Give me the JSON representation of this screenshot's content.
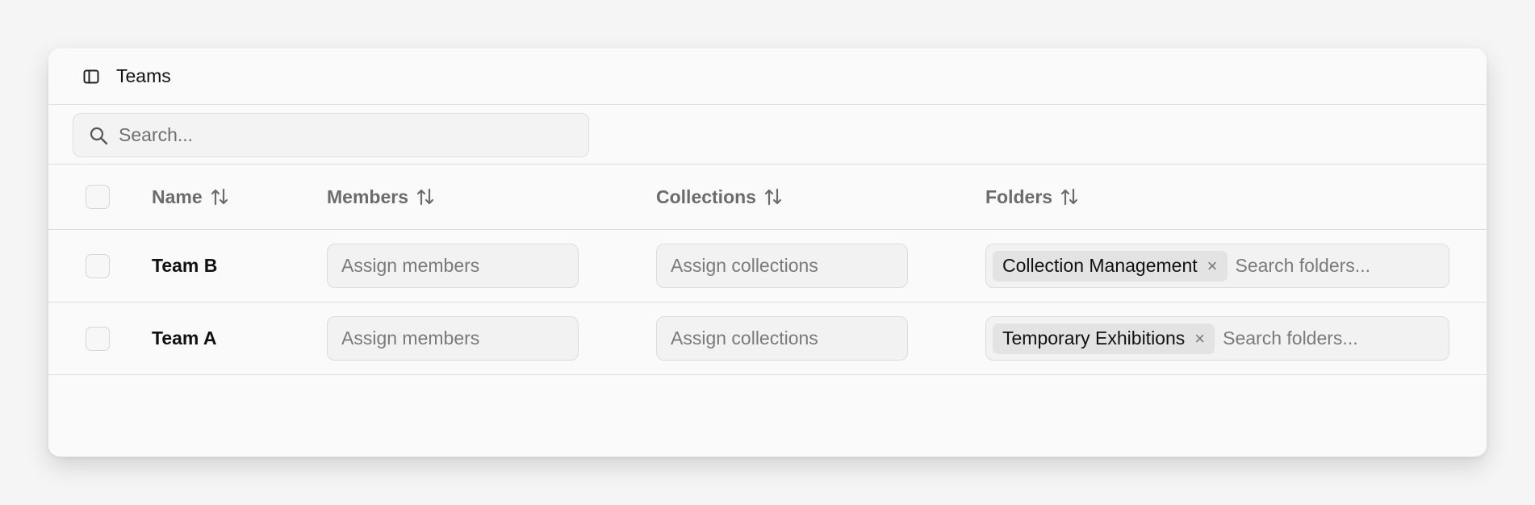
{
  "window": {
    "title": "Teams",
    "sidebar_icon": "sidebar-toggle-icon"
  },
  "search": {
    "placeholder": "Search...",
    "icon": "search-icon"
  },
  "table": {
    "columns": [
      {
        "label": "Name",
        "sortable": true
      },
      {
        "label": "Members",
        "sortable": true
      },
      {
        "label": "Collections",
        "sortable": true
      },
      {
        "label": "Folders",
        "sortable": true
      }
    ],
    "rows": [
      {
        "name": "Team B",
        "members_placeholder": "Assign members",
        "collections_placeholder": "Assign collections",
        "folder_chip": "Collection Management",
        "folder_remove": "×",
        "folders_placeholder": "Search folders..."
      },
      {
        "name": "Team A",
        "members_placeholder": "Assign members",
        "collections_placeholder": "Assign collections",
        "folder_chip": "Temporary Exhibitions",
        "folder_remove": "×",
        "folders_placeholder": "Search folders..."
      }
    ]
  }
}
